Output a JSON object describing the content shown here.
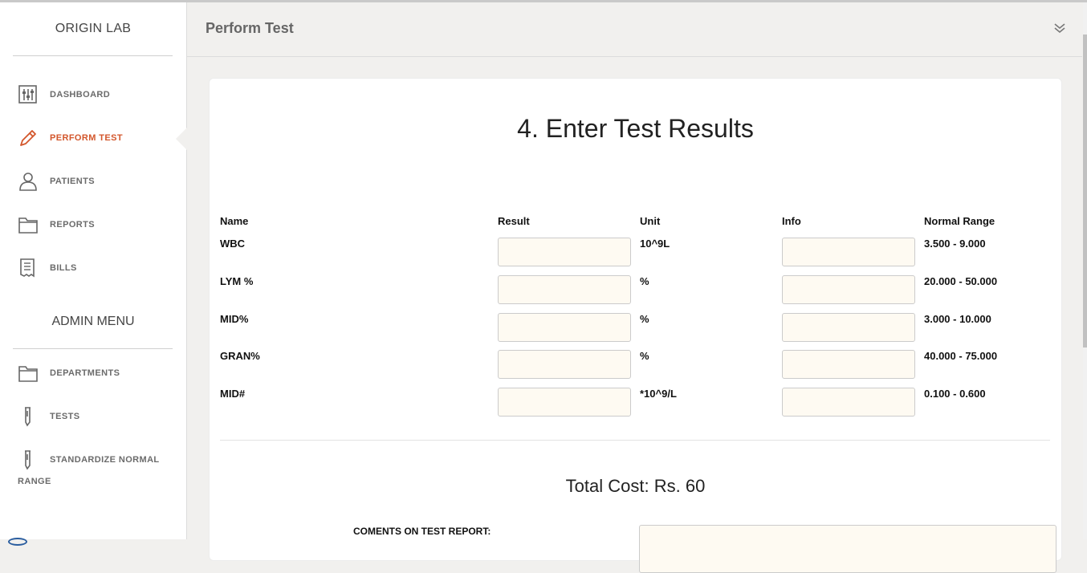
{
  "sidebar": {
    "brand": "ORIGIN LAB",
    "items": [
      {
        "label": "DASHBOARD",
        "icon": "sliders-icon"
      },
      {
        "label": "PERFORM TEST",
        "icon": "pencil-icon",
        "active": true
      },
      {
        "label": "PATIENTS",
        "icon": "user-icon"
      },
      {
        "label": "REPORTS",
        "icon": "folder-icon"
      },
      {
        "label": "BILLS",
        "icon": "receipt-icon"
      }
    ],
    "admin_title": "ADMIN MENU",
    "admin_items": [
      {
        "label": "DEPARTMENTS",
        "icon": "folder-icon"
      },
      {
        "label": "TESTS",
        "icon": "test-tube-icon"
      },
      {
        "label": "STANDARDIZE NORMAL",
        "label2": "RANGE",
        "icon": "test-tube-icon"
      }
    ]
  },
  "header": {
    "title": "Perform Test",
    "toggle_icon": "double-chevron-down-icon"
  },
  "main": {
    "heading": "4. Enter Test Results",
    "columns": [
      "Name",
      "Result",
      "Unit",
      "Info",
      "Normal Range"
    ],
    "rows": [
      {
        "name": "WBC",
        "result": "",
        "unit": "10^9L",
        "info": "",
        "range": "3.500 - 9.000"
      },
      {
        "name": "LYM %",
        "result": "",
        "unit": "%",
        "info": "",
        "range": "20.000 - 50.000"
      },
      {
        "name": "MID%",
        "result": "",
        "unit": "%",
        "info": "",
        "range": "3.000 - 10.000"
      },
      {
        "name": "GRAN%",
        "result": "",
        "unit": "%",
        "info": "",
        "range": "40.000 - 75.000"
      },
      {
        "name": "MID#",
        "result": "",
        "unit": "*10^9/L",
        "info": "",
        "range": "0.100 - 0.600"
      }
    ],
    "total_cost": "Total Cost: Rs. 60",
    "comments_label": "COMENTS ON TEST REPORT:",
    "comments_value": ""
  },
  "colors": {
    "accent": "#d3562b",
    "input_bg": "#fefaf2",
    "page_bg": "#f1f0ee"
  }
}
